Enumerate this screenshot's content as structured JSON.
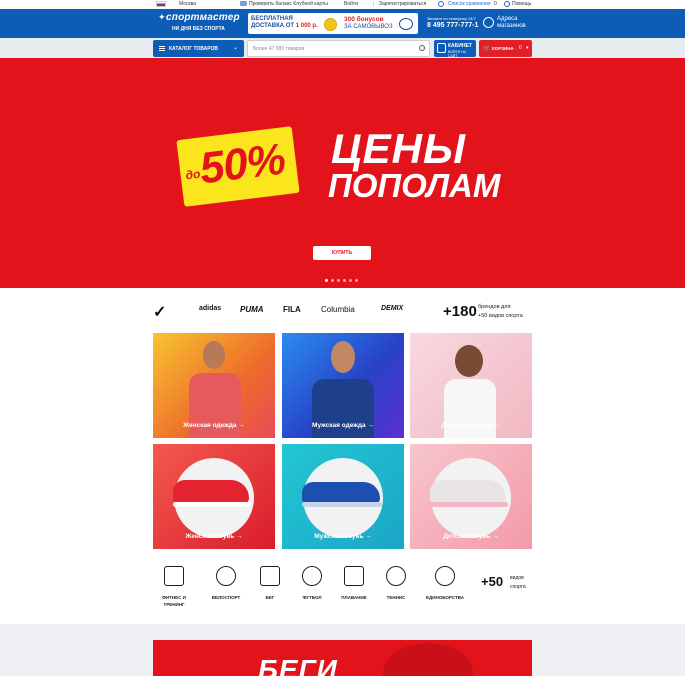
{
  "topbar": {
    "city": "Москва",
    "check_card": "Проверить баланс Клубной карты",
    "login": "Войти",
    "register": "Зарегистрироваться",
    "compare": "Список сравнения",
    "compare_count": "0",
    "help": "Помощь"
  },
  "header": {
    "logo_text": "спортмастер",
    "logo_slogan": "НИ ДНЯ БЕЗ СПОРТА",
    "promo_delivery_line1": "БЕСПЛАТНАЯ",
    "promo_delivery_line2": "ДОСТАВКА ОТ",
    "promo_delivery_amount": "1 000 р.",
    "promo_bonus": "300 бонусов",
    "promo_bonus_sub": "ЗА САМОВЫВОЗ",
    "phone_caption": "Звоните по телефону 24/7",
    "phone": "8 495 777-777-1",
    "address_line1": "Адреса",
    "address_line2": "магазинов"
  },
  "searchrow": {
    "catalog_label": "КАТАЛОГ ТОВАРОВ",
    "search_placeholder": "Более 47 000 товаров",
    "cabinet_label": "КАБИНЕТ",
    "cabinet_sub": "ВОЙТИ НА САЙТ",
    "cart_label": "КОРЗИНА",
    "cart_count": "0"
  },
  "hero": {
    "prefix": "до",
    "percent": "50%",
    "title_line1": "ЦЕНЫ",
    "title_line2": "ПОПОЛАМ",
    "buy_label": "КУПИТЬ",
    "slides_total": 6,
    "active_slide": 1,
    "colors": {
      "background": "#e3131c",
      "sticker": "#fbe61e"
    }
  },
  "brands": {
    "items": [
      "Nike",
      "adidas",
      "PUMA",
      "FILA",
      "Columbia",
      "DEMIX"
    ],
    "count": "+180",
    "caption_line1": "брендов для",
    "caption_line2": "+50 видов спорта"
  },
  "categories": [
    {
      "label": "Женская одежда →",
      "image": "woman-in-red-tshirt",
      "bg": "#f08a2a"
    },
    {
      "label": "Мужская одежда →",
      "image": "man-in-blue-tshirt",
      "bg": "#3a62d6"
    },
    {
      "label": "Детская одежда →",
      "image": "girl-in-white-tshirt",
      "bg": "#f2c6cf"
    },
    {
      "label": "Женская обувь →",
      "image": "red-sneaker",
      "bg": "#e0242a"
    },
    {
      "label": "Мужская обувь →",
      "image": "blue-sneaker",
      "bg": "#21b7c9"
    },
    {
      "label": "Детская обувь →",
      "image": "pink-sneaker",
      "bg": "#f5b4be"
    }
  ],
  "sports": {
    "items": [
      {
        "label_line1": "ФИТНЕС И",
        "label_line2": "ТРЕНИНГ",
        "icon": "dumbbell-icon"
      },
      {
        "label_line1": "ВЕЛОСПОРТ",
        "label_line2": "",
        "icon": "bicycle-icon"
      },
      {
        "label_line1": "БЕГ",
        "label_line2": "",
        "icon": "running-shoe-icon"
      },
      {
        "label_line1": "ФУТБОЛ",
        "label_line2": "",
        "icon": "football-icon"
      },
      {
        "label_line1": "ПЛАВАНИЕ",
        "label_line2": "",
        "icon": "swimmer-icon"
      },
      {
        "label_line1": "ТЕННИС",
        "label_line2": "",
        "icon": "tennis-icon"
      },
      {
        "label_line1": "ЕДИНОБОРСТВА",
        "label_line2": "",
        "icon": "boxing-glove-icon"
      }
    ],
    "count": "+50",
    "caption_line1": "видов",
    "caption_line2": "спорта"
  },
  "run_banner": {
    "text": "БЕГИ"
  }
}
